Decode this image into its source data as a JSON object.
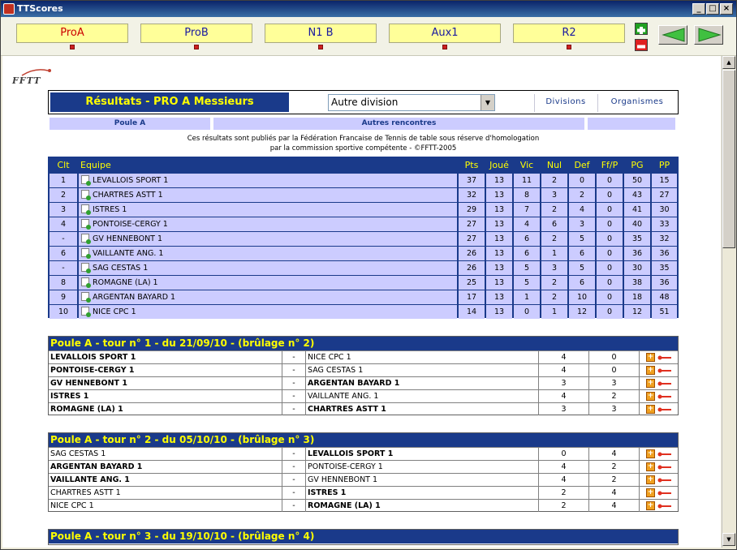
{
  "window": {
    "title": "TTScores"
  },
  "toolbar": {
    "tabs": [
      {
        "label": "ProA",
        "active": true
      },
      {
        "label": "ProB",
        "active": false
      },
      {
        "label": "N1 B",
        "active": false
      },
      {
        "label": "Aux1",
        "active": false
      },
      {
        "label": "R2",
        "active": false
      }
    ]
  },
  "logo": {
    "text": "FFTT"
  },
  "header": {
    "title": "Résultats - PRO A Messieurs",
    "select_value": "Autre division",
    "link_divisions": "Divisions",
    "link_organismes": "Organismes"
  },
  "nav": {
    "poule": "Poule A",
    "autres": "Autres rencontres"
  },
  "notice": {
    "line1": "Ces résultats sont publiés par la Fédération Francaise de Tennis de table sous réserve d'homologation",
    "line2": "par la commission sportive compétente - ©FFTT-2005"
  },
  "standings": {
    "headers": [
      "Clt",
      "Equipe",
      "Pts",
      "Joué",
      "Vic",
      "Nul",
      "Def",
      "Ff/P",
      "PG",
      "PP"
    ],
    "rows": [
      [
        "1",
        "LEVALLOIS SPORT 1",
        "37",
        "13",
        "11",
        "2",
        "0",
        "0",
        "50",
        "15"
      ],
      [
        "2",
        "CHARTRES ASTT 1",
        "32",
        "13",
        "8",
        "3",
        "2",
        "0",
        "43",
        "27"
      ],
      [
        "3",
        "ISTRES 1",
        "29",
        "13",
        "7",
        "2",
        "4",
        "0",
        "41",
        "30"
      ],
      [
        "4",
        "PONTOISE-CERGY 1",
        "27",
        "13",
        "4",
        "6",
        "3",
        "0",
        "40",
        "33"
      ],
      [
        "-",
        "GV HENNEBONT 1",
        "27",
        "13",
        "6",
        "2",
        "5",
        "0",
        "35",
        "32"
      ],
      [
        "6",
        "VAILLANTE ANG. 1",
        "26",
        "13",
        "6",
        "1",
        "6",
        "0",
        "36",
        "36"
      ],
      [
        "-",
        "SAG CESTAS 1",
        "26",
        "13",
        "5",
        "3",
        "5",
        "0",
        "30",
        "35"
      ],
      [
        "8",
        "ROMAGNE (LA) 1",
        "25",
        "13",
        "5",
        "2",
        "6",
        "0",
        "38",
        "36"
      ],
      [
        "9",
        "ARGENTAN BAYARD 1",
        "17",
        "13",
        "1",
        "2",
        "10",
        "0",
        "18",
        "48"
      ],
      [
        "10",
        "NICE CPC 1",
        "14",
        "13",
        "0",
        "1",
        "12",
        "0",
        "12",
        "51"
      ]
    ]
  },
  "poules": [
    {
      "title": "Poule A - tour n° 1 - du 21/09/10 - (brûlage n° 2)",
      "matches": [
        {
          "home": "LEVALLOIS SPORT 1",
          "sep": "-",
          "away": "NICE CPC 1",
          "sh": "4",
          "sa": "0",
          "win": "home"
        },
        {
          "home": "PONTOISE-CERGY 1",
          "sep": "-",
          "away": "SAG CESTAS 1",
          "sh": "4",
          "sa": "0",
          "win": "home"
        },
        {
          "home": "GV HENNEBONT 1",
          "sep": "-",
          "away": "ARGENTAN BAYARD 1",
          "sh": "3",
          "sa": "3",
          "win": "both"
        },
        {
          "home": "ISTRES 1",
          "sep": "-",
          "away": "VAILLANTE ANG. 1",
          "sh": "4",
          "sa": "2",
          "win": "home"
        },
        {
          "home": "ROMAGNE (LA) 1",
          "sep": "-",
          "away": "CHARTRES ASTT 1",
          "sh": "3",
          "sa": "3",
          "win": "both"
        }
      ]
    },
    {
      "title": "Poule A - tour n° 2 - du 05/10/10 - (brûlage n° 3)",
      "matches": [
        {
          "home": "SAG CESTAS 1",
          "sep": "-",
          "away": "LEVALLOIS SPORT 1",
          "sh": "0",
          "sa": "4",
          "win": "away"
        },
        {
          "home": "ARGENTAN BAYARD 1",
          "sep": "-",
          "away": "PONTOISE-CERGY 1",
          "sh": "4",
          "sa": "2",
          "win": "home"
        },
        {
          "home": "VAILLANTE ANG. 1",
          "sep": "-",
          "away": "GV HENNEBONT 1",
          "sh": "4",
          "sa": "2",
          "win": "home"
        },
        {
          "home": "CHARTRES ASTT 1",
          "sep": "-",
          "away": "ISTRES 1",
          "sh": "2",
          "sa": "4",
          "win": "away"
        },
        {
          "home": "NICE CPC 1",
          "sep": "-",
          "away": "ROMAGNE (LA) 1",
          "sh": "2",
          "sa": "4",
          "win": "away"
        }
      ]
    },
    {
      "title": "Poule A - tour n° 3 - du 19/10/10 - (brûlage n° 4)",
      "matches": []
    }
  ]
}
